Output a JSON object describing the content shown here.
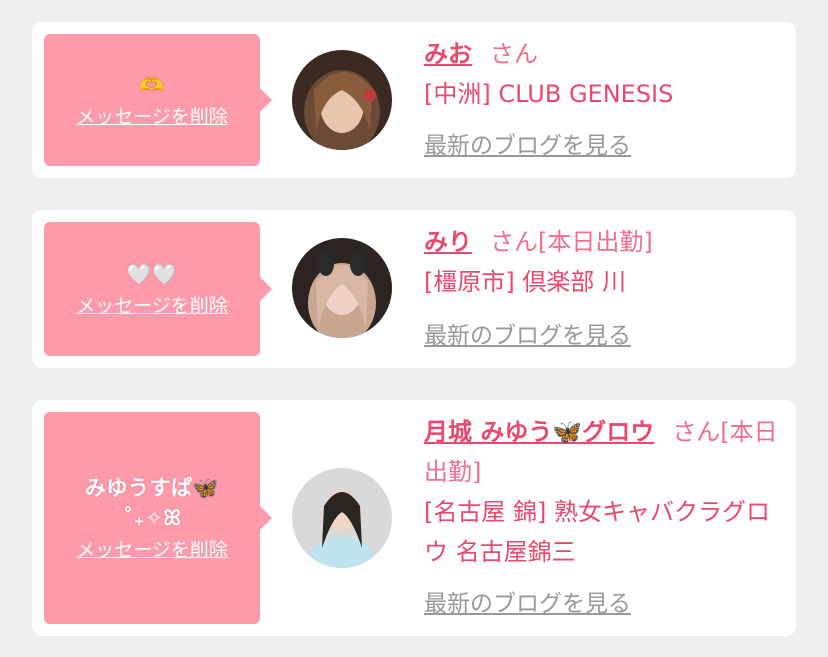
{
  "cards": [
    {
      "message": "🫶",
      "delete_label": "メッセージを削除",
      "name": "みお",
      "san_suffix": "さん",
      "shop": "[中洲] CLUB GENESIS",
      "blog_link": "最新のブログを見る"
    },
    {
      "message": "🤍🤍",
      "delete_label": "メッセージを削除",
      "name": "みり",
      "san_suffix": "さん[本日出勤]",
      "shop": "[橿原市] 倶楽部 川",
      "blog_link": "最新のブログを見る"
    },
    {
      "message": "みゆうすぱ🦋\n˚₊✧ꕤ",
      "delete_label": "メッセージを削除",
      "name": "月城 みゆう🦋グロウ",
      "san_suffix": "さん[本日出勤]",
      "shop": "[名古屋 錦] 熟女キャバクラグロウ 名古屋錦三",
      "blog_link": "最新のブログを見る"
    }
  ],
  "colors": {
    "background": "#efefef",
    "bubble": "#ff9aab",
    "accent_text": "#e8496c",
    "link_gray": "#999999"
  }
}
